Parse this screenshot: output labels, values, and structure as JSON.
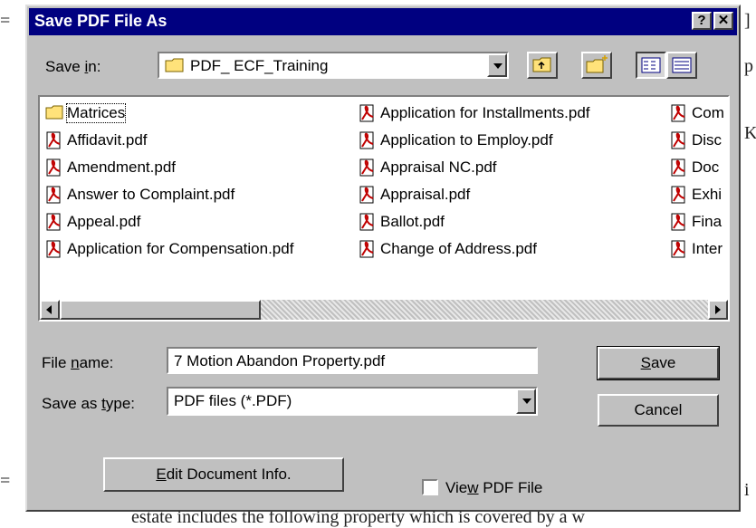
{
  "background": {
    "bottom_text": "estate includes the following property which is covered by a w",
    "right_fragments": [
      "p",
      "K",
      "i"
    ]
  },
  "dialog": {
    "title": "Save PDF File As",
    "help_btn": "?",
    "close_btn": "✕",
    "save_in_label_pre": "Save ",
    "save_in_label_u": "i",
    "save_in_label_post": "n:",
    "save_in_value": "PDF_ ECF_Training",
    "files": [
      {
        "name": "Matrices",
        "type": "folder"
      },
      {
        "name": "Affidavit.pdf",
        "type": "pdf"
      },
      {
        "name": "Amendment.pdf",
        "type": "pdf"
      },
      {
        "name": "Answer to Complaint.pdf",
        "type": "pdf"
      },
      {
        "name": "Appeal.pdf",
        "type": "pdf"
      },
      {
        "name": "Application for Compensation.pdf",
        "type": "pdf"
      },
      {
        "name": "Application for Installments.pdf",
        "type": "pdf"
      },
      {
        "name": "Application to Employ.pdf",
        "type": "pdf"
      },
      {
        "name": "Appraisal NC.pdf",
        "type": "pdf"
      },
      {
        "name": "Appraisal.pdf",
        "type": "pdf"
      },
      {
        "name": "Ballot.pdf",
        "type": "pdf"
      },
      {
        "name": "Change of Address.pdf",
        "type": "pdf"
      },
      {
        "name": "Com",
        "type": "pdf"
      },
      {
        "name": "Disc",
        "type": "pdf"
      },
      {
        "name": "Doc",
        "type": "pdf"
      },
      {
        "name": "Exhi",
        "type": "pdf"
      },
      {
        "name": "Fina",
        "type": "pdf"
      },
      {
        "name": "Inter",
        "type": "pdf"
      }
    ],
    "file_name_label_pre": "File ",
    "file_name_label_u": "n",
    "file_name_label_post": "ame:",
    "file_name_value": "7 Motion Abandon Property.pdf",
    "save_type_label_pre": "Save as ",
    "save_type_label_u": "t",
    "save_type_label_post": "ype:",
    "save_type_value": "PDF files (*.PDF)",
    "save_btn_u": "S",
    "save_btn_post": "ave",
    "cancel_btn": "Cancel",
    "edit_info_u": "E",
    "edit_info_post": "dit Document Info.",
    "view_pdf_pre": "Vie",
    "view_pdf_u": "w",
    "view_pdf_post": " PDF File",
    "view_pdf_checked": false
  }
}
